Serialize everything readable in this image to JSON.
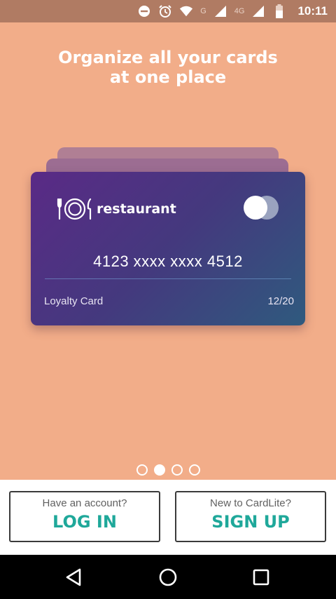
{
  "status_bar": {
    "time": "10:11",
    "network_g": "G",
    "network_4g": "4G",
    "icons": [
      "do-not-disturb-icon",
      "alarm-icon",
      "wifi-icon",
      "signal-icon",
      "signal-icon",
      "battery-icon"
    ]
  },
  "headline": {
    "line1": "Organize all your cards",
    "line2": "at one place"
  },
  "card": {
    "brand": "restaurant",
    "number": "4123 xxxx xxxx 4512",
    "type": "Loyalty Card",
    "expiry": "12/20"
  },
  "pager": {
    "total": 4,
    "active_index": 1
  },
  "auth": {
    "login_hint": "Have an account?",
    "login_label": "LOG IN",
    "signup_hint": "New to CardLite?",
    "signup_label": "SIGN UP"
  },
  "colors": {
    "background": "#f2ad89",
    "accent": "#1fa89a",
    "card_gradient_start": "#5a2a86",
    "card_gradient_end": "#2f5a7e"
  }
}
